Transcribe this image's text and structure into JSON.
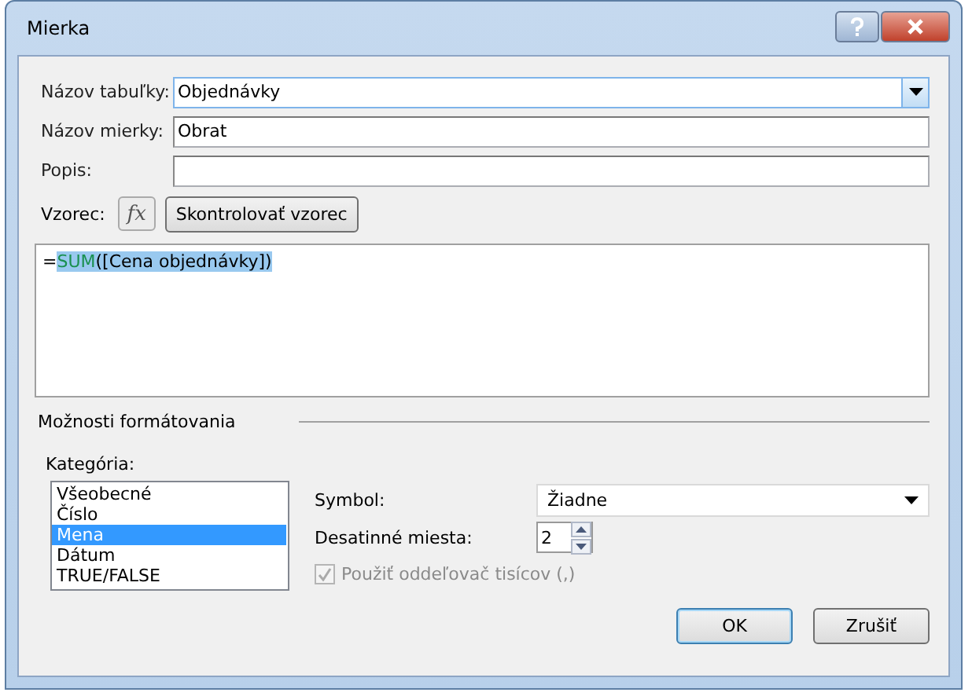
{
  "window": {
    "title": "Mierka"
  },
  "fields": [
    {
      "kind": "combo",
      "label": "Názov tabuľky:",
      "value": "Objednávky"
    },
    {
      "kind": "text",
      "label": "Názov mierky:",
      "value": "Obrat"
    },
    {
      "kind": "text",
      "label": "Popis:"
    }
  ],
  "formula": {
    "label": "Vzorec:",
    "fx": "fx",
    "check_button": "Skontrolovať vzorec",
    "prefix": "=",
    "function": "SUM",
    "argument": "([Cena objednávky])",
    "selected": true
  },
  "formatting": {
    "heading": "Možnosti formátovania",
    "category_label": "Kategória:",
    "categories": [
      {
        "label": "Všeobecné",
        "selected": false
      },
      {
        "label": "Číslo",
        "selected": false
      },
      {
        "label": "Mena",
        "selected": true
      },
      {
        "label": "Dátum",
        "selected": false
      },
      {
        "label": "TRUE/FALSE",
        "selected": false
      }
    ],
    "symbol_label": "Symbol:",
    "symbol_value": "Žiadne",
    "decimals_label": "Desatinné miesta:",
    "decimals_value": "2",
    "separator": {
      "label": "Použiť oddeľovač tisícov (,)",
      "checked": true,
      "disabled": true
    }
  },
  "buttons": [
    "OK",
    "Zrušiť"
  ]
}
